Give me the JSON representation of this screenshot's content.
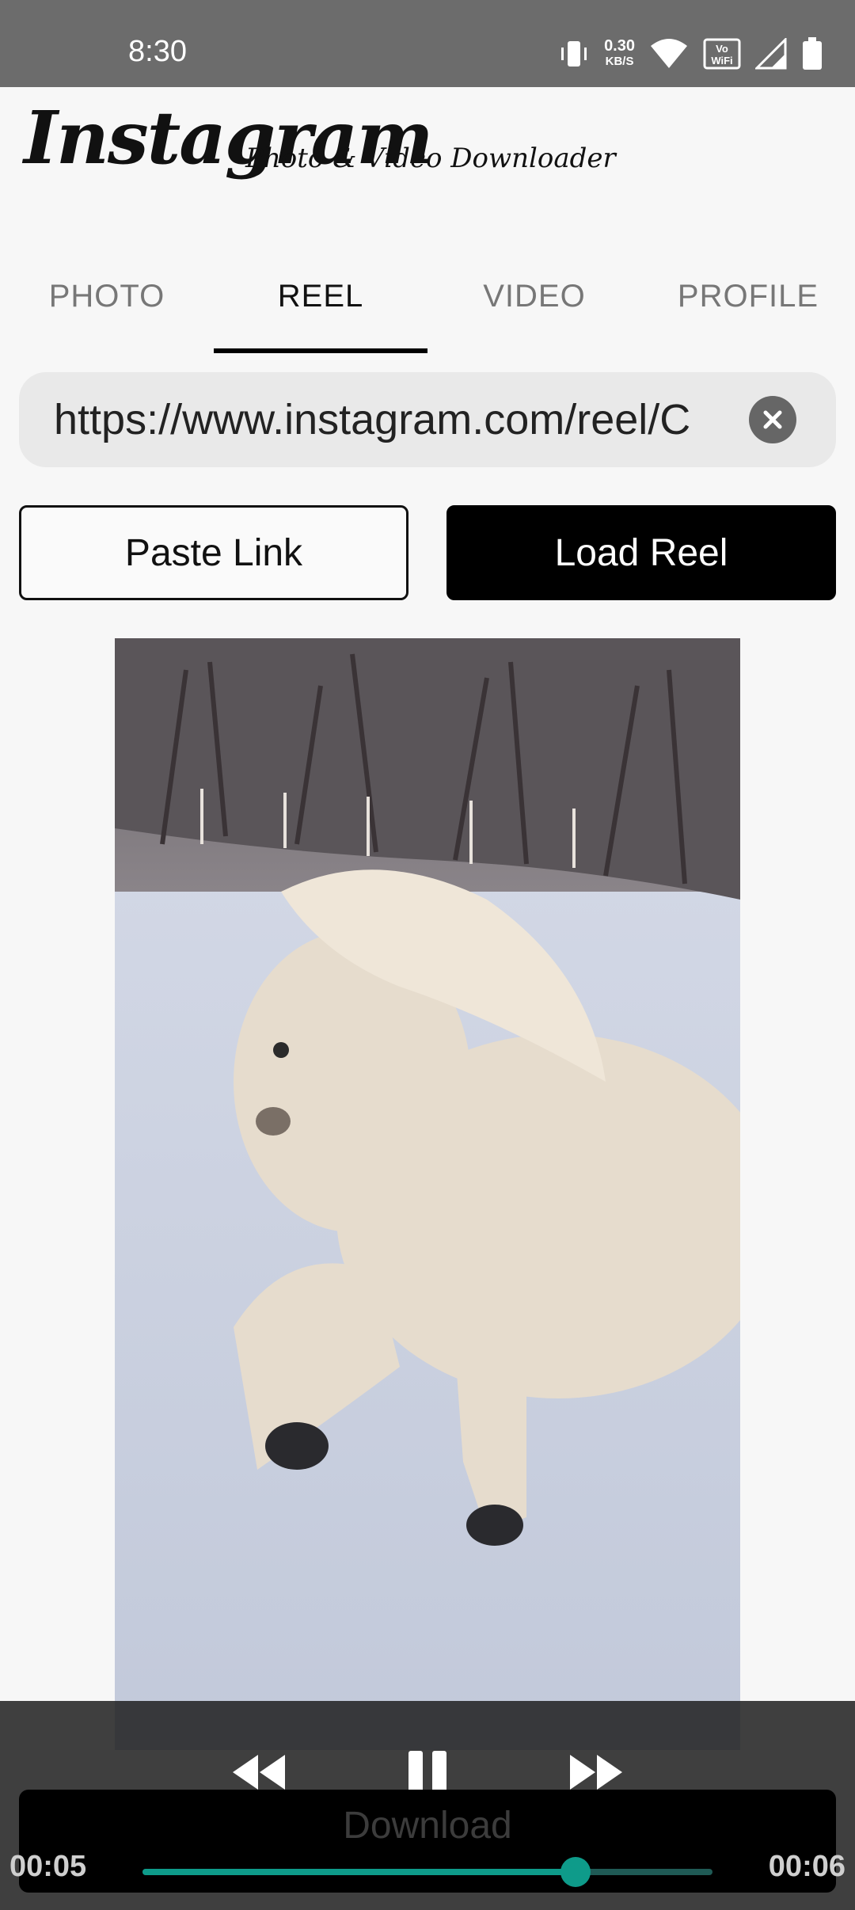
{
  "status_bar": {
    "time": "8:30",
    "net_speed_value": "0.30",
    "net_speed_unit": "KB/S",
    "icons": [
      "vibrate-icon",
      "wifi-icon",
      "vowifi-icon",
      "signal-icon",
      "battery-icon"
    ]
  },
  "header": {
    "logo_text": "Instagram",
    "subtitle": "Photo & Video Downloader"
  },
  "tabs": [
    {
      "label": "PHOTO",
      "active": false
    },
    {
      "label": "REEL",
      "active": true
    },
    {
      "label": "VIDEO",
      "active": false
    },
    {
      "label": "PROFILE",
      "active": false
    }
  ],
  "url_input": {
    "value": "https://www.instagram.com/reel/C"
  },
  "buttons": {
    "paste_label": "Paste Link",
    "load_label": "Load Reel"
  },
  "player": {
    "current_time": "00:05",
    "duration": "00:06",
    "progress": 0.76,
    "download_label": "Download",
    "accent_color": "#0e9b8a"
  }
}
